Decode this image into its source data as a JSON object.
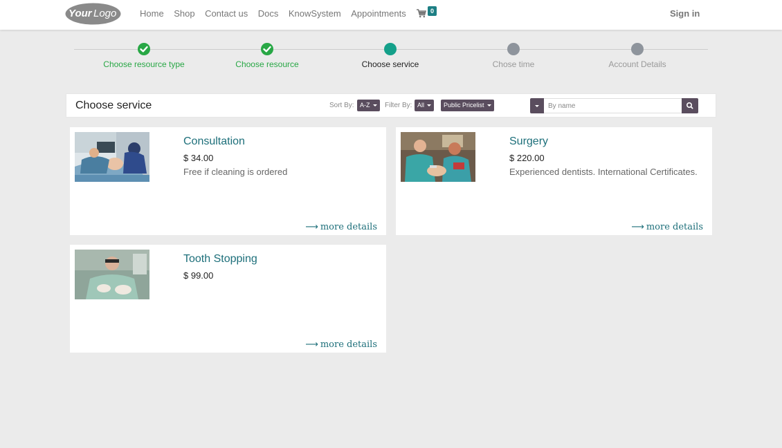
{
  "header": {
    "logo_text": "YourLogo",
    "nav": [
      "Home",
      "Shop",
      "Contact us",
      "Docs",
      "KnowSystem",
      "Appointments"
    ],
    "cart_count": "0",
    "signin_label": "Sign in"
  },
  "wizard": {
    "steps": [
      {
        "label": "Choose resource type",
        "state": "done"
      },
      {
        "label": "Choose resource",
        "state": "done"
      },
      {
        "label": "Choose service",
        "state": "current"
      },
      {
        "label": "Chose time",
        "state": "todo"
      },
      {
        "label": "Account Details",
        "state": "todo"
      }
    ]
  },
  "toolbar": {
    "title": "Choose service",
    "sort_label": "Sort By:",
    "sort_value": "A-Z",
    "filter_label": "Filter By:",
    "filter_value": "All",
    "pricelist_value": "Public Pricelist",
    "search_placeholder": "By name"
  },
  "services": [
    {
      "name": "Consultation",
      "price": "$ 34.00",
      "description": "Free if cleaning is ordered",
      "more_label": "more details"
    },
    {
      "name": "Surgery",
      "price": "$ 220.00",
      "description": "Experienced dentists. International Certificates.",
      "more_label": "more details"
    },
    {
      "name": "Tooth Stopping",
      "price": "$ 99.00",
      "description": "",
      "more_label": "more details"
    }
  ],
  "colors": {
    "accent": "#1d6f7a",
    "done": "#28a745",
    "current": "#14a08a",
    "todo": "#8e949c",
    "control": "#5a4d5e"
  }
}
